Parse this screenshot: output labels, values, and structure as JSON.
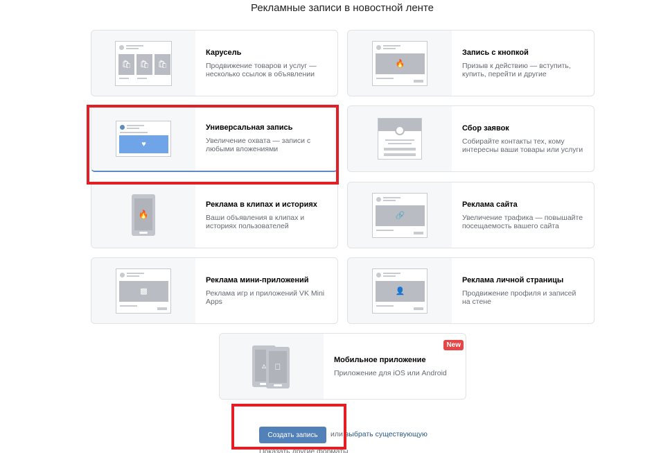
{
  "page": {
    "title": "Рекламные записи в новостной ленте"
  },
  "cards": [
    {
      "name": "Карусель",
      "desc": "Продвижение товаров и услуг — несколько ссылок в объявлении",
      "icon": "carousel-icon"
    },
    {
      "name": "Запись с кнопкой",
      "desc": "Призыв к действию — вступить, купить, перейти и другие",
      "icon": "fire-icon"
    },
    {
      "name": "Универсальная запись",
      "desc": "Увеличение охвата — записи с любыми вложениями",
      "icon": "heart-icon",
      "selected": true
    },
    {
      "name": "Сбор заявок",
      "desc": "Собирайте контакты тех, кому интересны ваши товары или услуги",
      "icon": "form-icon"
    },
    {
      "name": "Реклама в клипах и историях",
      "desc": "Ваши объявления в клипах и историях пользователей",
      "icon": "fire-icon"
    },
    {
      "name": "Реклама сайта",
      "desc": "Увеличение трафика — повышайте посещаемость вашего сайта",
      "icon": "link-icon"
    },
    {
      "name": "Реклама мини-приложений",
      "desc": "Реклама игр и приложений VK Mini Apps",
      "icon": "apps-icon"
    },
    {
      "name": "Реклама личной страницы",
      "desc": "Продвижение профиля и записей на стене",
      "icon": "person-icon"
    },
    {
      "name": "Мобильное приложение",
      "desc": "Приложение для iOS или Android",
      "icon": "phone-apps-icon",
      "badge": "New"
    }
  ],
  "actions": {
    "create_label": "Создать запись",
    "or_text": "или",
    "choose_existing": "выбрать существующую",
    "other_formats": "Показать другие форматы"
  },
  "colors": {
    "accent": "#5181b8",
    "badge": "#e64646",
    "highlight": "#e31e24"
  }
}
